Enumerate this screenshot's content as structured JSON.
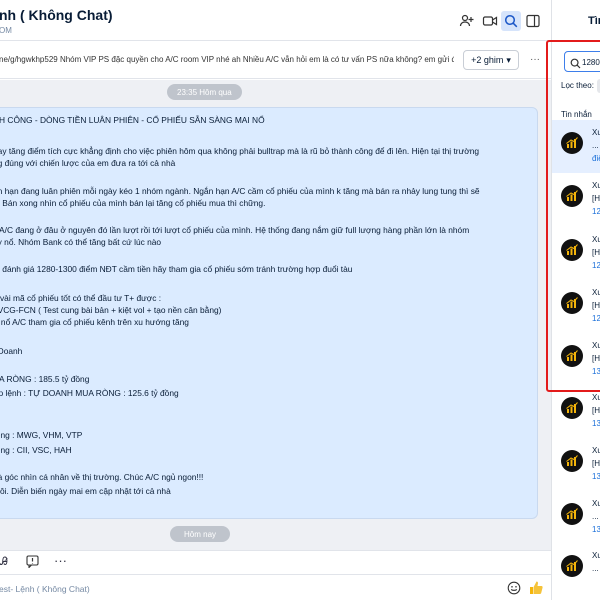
{
  "chat": {
    "title": "nh ( Không Chat)",
    "subtitle": "OM",
    "pinned_text": "ne/g/hgwkhp529 Nhóm VIP PS đặc quyền cho A/C room VIP nhé ah Nhiều A/C vẫn hỏi em là có tư vấn PS nữa không? em gửi đ...",
    "pin_button": "+2 ghim",
    "time_yesterday": "23:35 Hôm qua",
    "time_today": "Hôm nay",
    "message_lines": [
      "NH CÔNG - DÒNG TIỀN LUÂN PHIÊN - CỔ PHIẾU SẴN SÀNG MAI NỔ",
      "nay tăng điểm tích cực khẳng định cho việc phiên hôm qua không phải bulltrap mà là rũ bỏ thành công để đi lên. Hiện tại thị trường",
      "ng đúng với chiến lược của em đưa ra tới cả nhà",
      "ắn hạn đang luân phiên mỗi ngày kéo 1 nhóm ngành. Ngắn hạn A/C cầm cổ phiếu của mình k tăng mà bán ra nhảy lung tung thì sẽ",
      "a. Bán xong nhìn cổ phiếu của mình bán lại tăng cổ phiếu mua thì chững.",
      "y A/C đang ở đâu ở nguyên đó lần lượt rồi tới lượt cổ phiếu của mình. Hệ thống đang nắm giữ full lượng hàng phần lớn là nhóm",
      "ày nổ. Nhóm Bank có thể tăng bất cứ lúc nào",
      "m đánh giá 1280-1300 điểm NĐT cầm tiền hãy tham gia cổ phiếu sớm tránh trường hợp đuổi tàu",
      "1 vài mã cổ phiếu tốt có thể đầu tư T+ được :",
      ": VCG-FCN ( Test cung bài bản + kiệt vol + tạo nền cân bằng)",
      "ư nổ A/C tham gia cổ phiếu kênh trên xu hướng tăng",
      "/ Doanh",
      "UA RÒNG : 185.5 tỷ đồng",
      "ớp lệnh : TỰ DOANH MUA RÒNG : 125.6 tỷ đồng",
      "ròng : MWG, VHM, VTP",
      "ròng : CII, VSC, HAH",
      "hà góc nhìn cá nhân về thị trường. Chúc A/C ngủ ngon!!!",
      "thôi. Diễn biến ngày mai em cập nhật tới cả nhà"
    ],
    "input_placeholder": "est- Lệnh ( Không Chat)"
  },
  "panel": {
    "title": "Tìm",
    "search_value": "1280",
    "filter_label": "Lọc theo:",
    "section_label": "Tin nhắn",
    "results": [
      {
        "l1": "Xu",
        "l2": "... T",
        "l3": "điể"
      },
      {
        "l1": "Xu",
        "l2": "[H",
        "l3": "12"
      },
      {
        "l1": "Xu",
        "l2": "[H",
        "l3": "12"
      },
      {
        "l1": "Xu",
        "l2": "[H",
        "l3": "12"
      },
      {
        "l1": "Xu",
        "l2": "[H",
        "l3": "13"
      },
      {
        "l1": "Xu",
        "l2": "[H",
        "l3": "13"
      },
      {
        "l1": "Xu",
        "l2": "[H",
        "l3": "13"
      },
      {
        "l1": "Xu",
        "l2": "... ",
        "l3": "13"
      },
      {
        "l1": "Xu",
        "l2": "... ",
        "l3": ""
      }
    ]
  },
  "colors": {
    "accent": "#3d7eea",
    "highlight": "#e31b1b",
    "bubble": "#dbebff"
  }
}
